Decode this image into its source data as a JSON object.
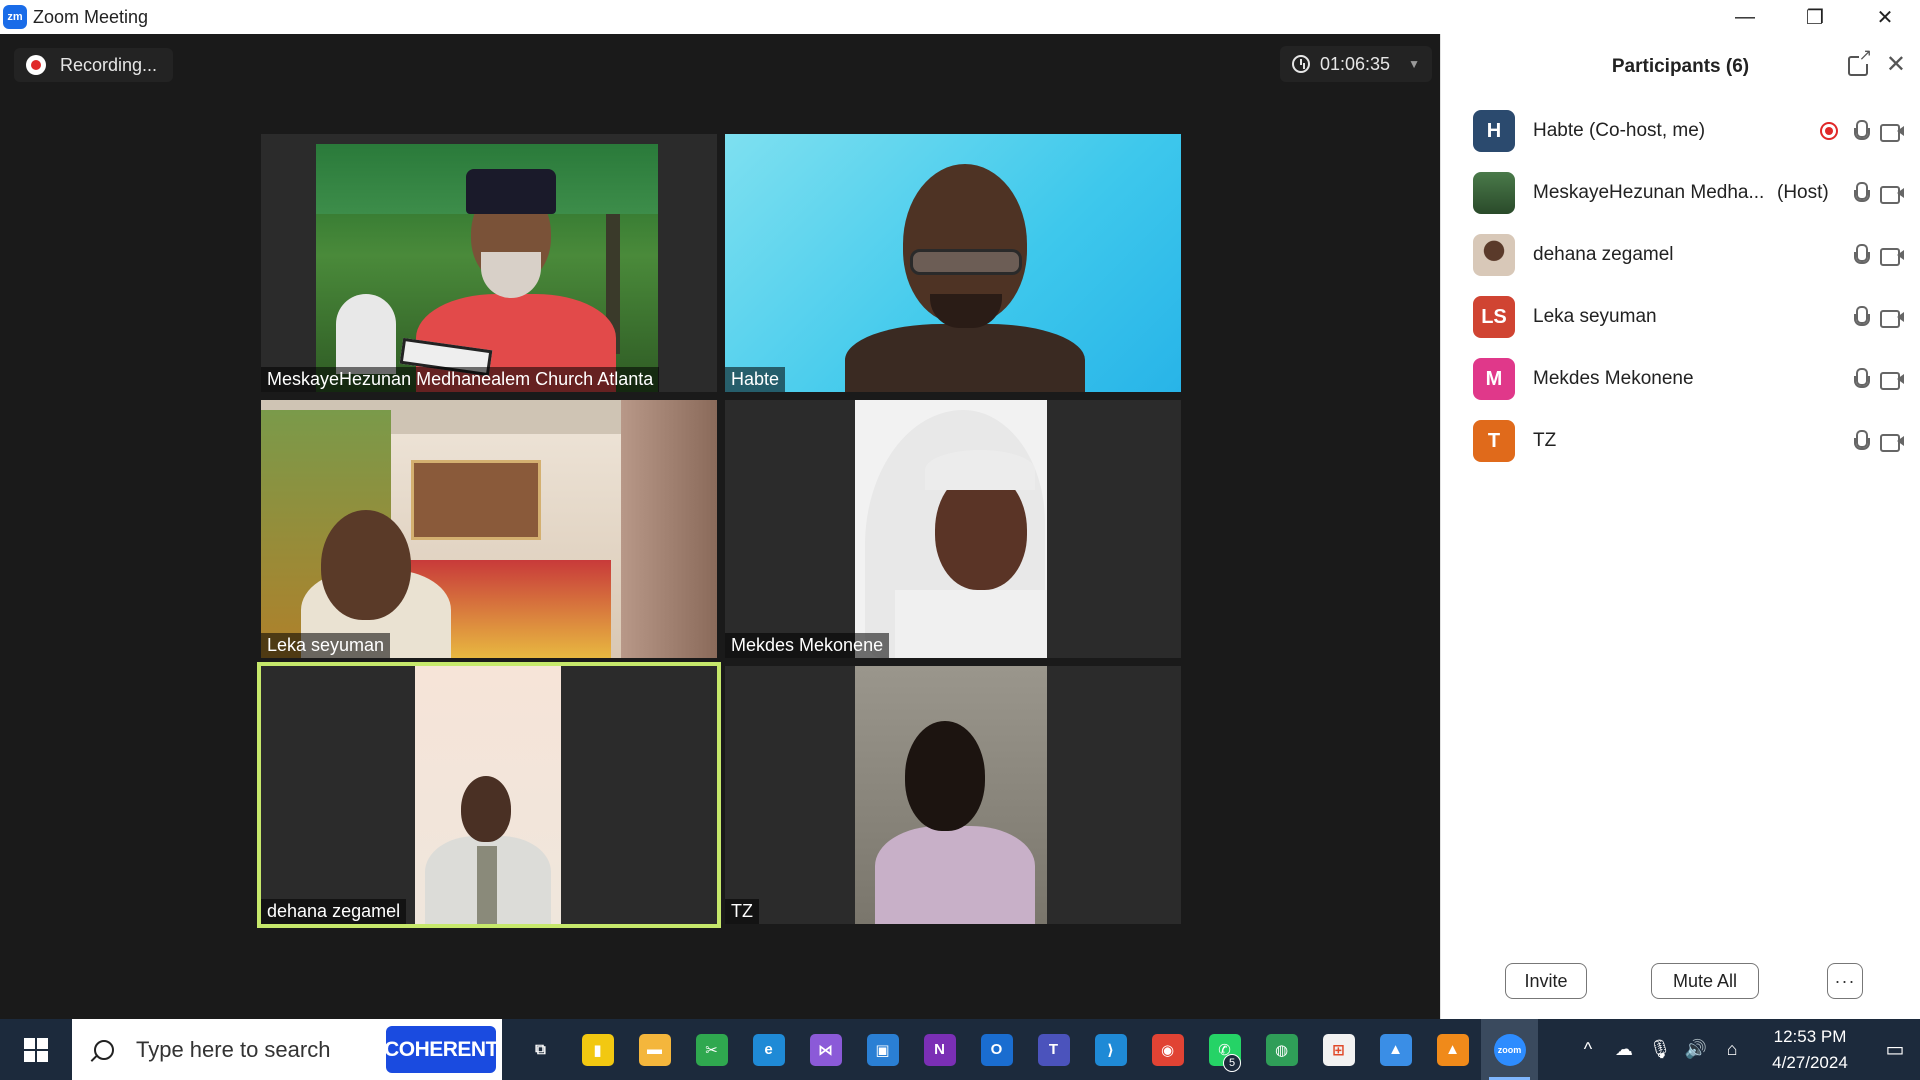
{
  "window": {
    "logo": "zm",
    "title": "Zoom Meeting",
    "minimize": "—",
    "restore": "❐",
    "close": "✕"
  },
  "meeting": {
    "recording_label": "Recording...",
    "timer": "01:06:35",
    "tiles": [
      {
        "name": "MeskayeHezunan Medhanealem Church Atlanta"
      },
      {
        "name": "Habte"
      },
      {
        "name": "Leka seyuman"
      },
      {
        "name": "Mekdes Mekonene"
      },
      {
        "name": "dehana zegamel",
        "active_speaker": true
      },
      {
        "name": "TZ"
      }
    ]
  },
  "participants": {
    "title": "Participants (6)",
    "items": [
      {
        "initials": "H",
        "name": "Habte (Co-host, me)",
        "role": "",
        "avatar_color": "#2b4a6e",
        "recording": true
      },
      {
        "initials": "",
        "name": "MeskayeHezunan Medha...",
        "role": "(Host)",
        "avatar_color": "#3b6b3a",
        "recording": false
      },
      {
        "initials": "",
        "name": "dehana zegamel",
        "role": "",
        "avatar_color": "#b98d6a",
        "recording": false
      },
      {
        "initials": "LS",
        "name": "Leka seyuman",
        "role": "",
        "avatar_color": "#d04432",
        "recording": false
      },
      {
        "initials": "M",
        "name": "Mekdes Mekonene",
        "role": "",
        "avatar_color": "#e0388a",
        "recording": false
      },
      {
        "initials": "T",
        "name": "TZ",
        "role": "",
        "avatar_color": "#e06a1b",
        "recording": false
      }
    ],
    "invite_label": "Invite",
    "mute_all_label": "Mute All",
    "more_label": "···"
  },
  "taskbar": {
    "search_placeholder": "Type here to search",
    "search_promo": "COHERENT",
    "apps": [
      {
        "name": "task-view",
        "glyph": "⧉",
        "color": "#1c2a3c"
      },
      {
        "name": "power-bi",
        "glyph": "▮",
        "color": "#f2c811"
      },
      {
        "name": "file-explorer",
        "glyph": "▬",
        "color": "#f4b63c"
      },
      {
        "name": "snipping-tool",
        "glyph": "✂",
        "color": "#2fa84f"
      },
      {
        "name": "edge",
        "glyph": "e",
        "color": "#1f8ad6"
      },
      {
        "name": "visual-studio",
        "glyph": "⋈",
        "color": "#8b5ad8"
      },
      {
        "name": "remote-desktop",
        "glyph": "▣",
        "color": "#2a7fd4"
      },
      {
        "name": "onenote",
        "glyph": "N",
        "color": "#7b2fb5"
      },
      {
        "name": "outlook",
        "glyph": "O",
        "color": "#1a6dd0"
      },
      {
        "name": "teams",
        "glyph": "T",
        "color": "#4b53bc"
      },
      {
        "name": "vscode",
        "glyph": "⟩",
        "color": "#1f8ad6"
      },
      {
        "name": "chrome",
        "glyph": "◉",
        "color": "#e14334"
      },
      {
        "name": "whatsapp",
        "glyph": "✆",
        "color": "#25d366",
        "badge": "5"
      },
      {
        "name": "maps-globe",
        "glyph": "◍",
        "color": "#2f9e58"
      },
      {
        "name": "ms-store",
        "glyph": "⊞",
        "color": "#f2f2f2"
      },
      {
        "name": "photos",
        "glyph": "▲",
        "color": "#3a8ee6"
      },
      {
        "name": "vlc",
        "glyph": "▲",
        "color": "#f08a1a"
      },
      {
        "name": "zoom",
        "glyph": "zoom",
        "color": "#2d8cff",
        "active": true
      }
    ],
    "tray": {
      "chevron": "^",
      "time": "12:53 PM",
      "date": "4/27/2024"
    }
  }
}
